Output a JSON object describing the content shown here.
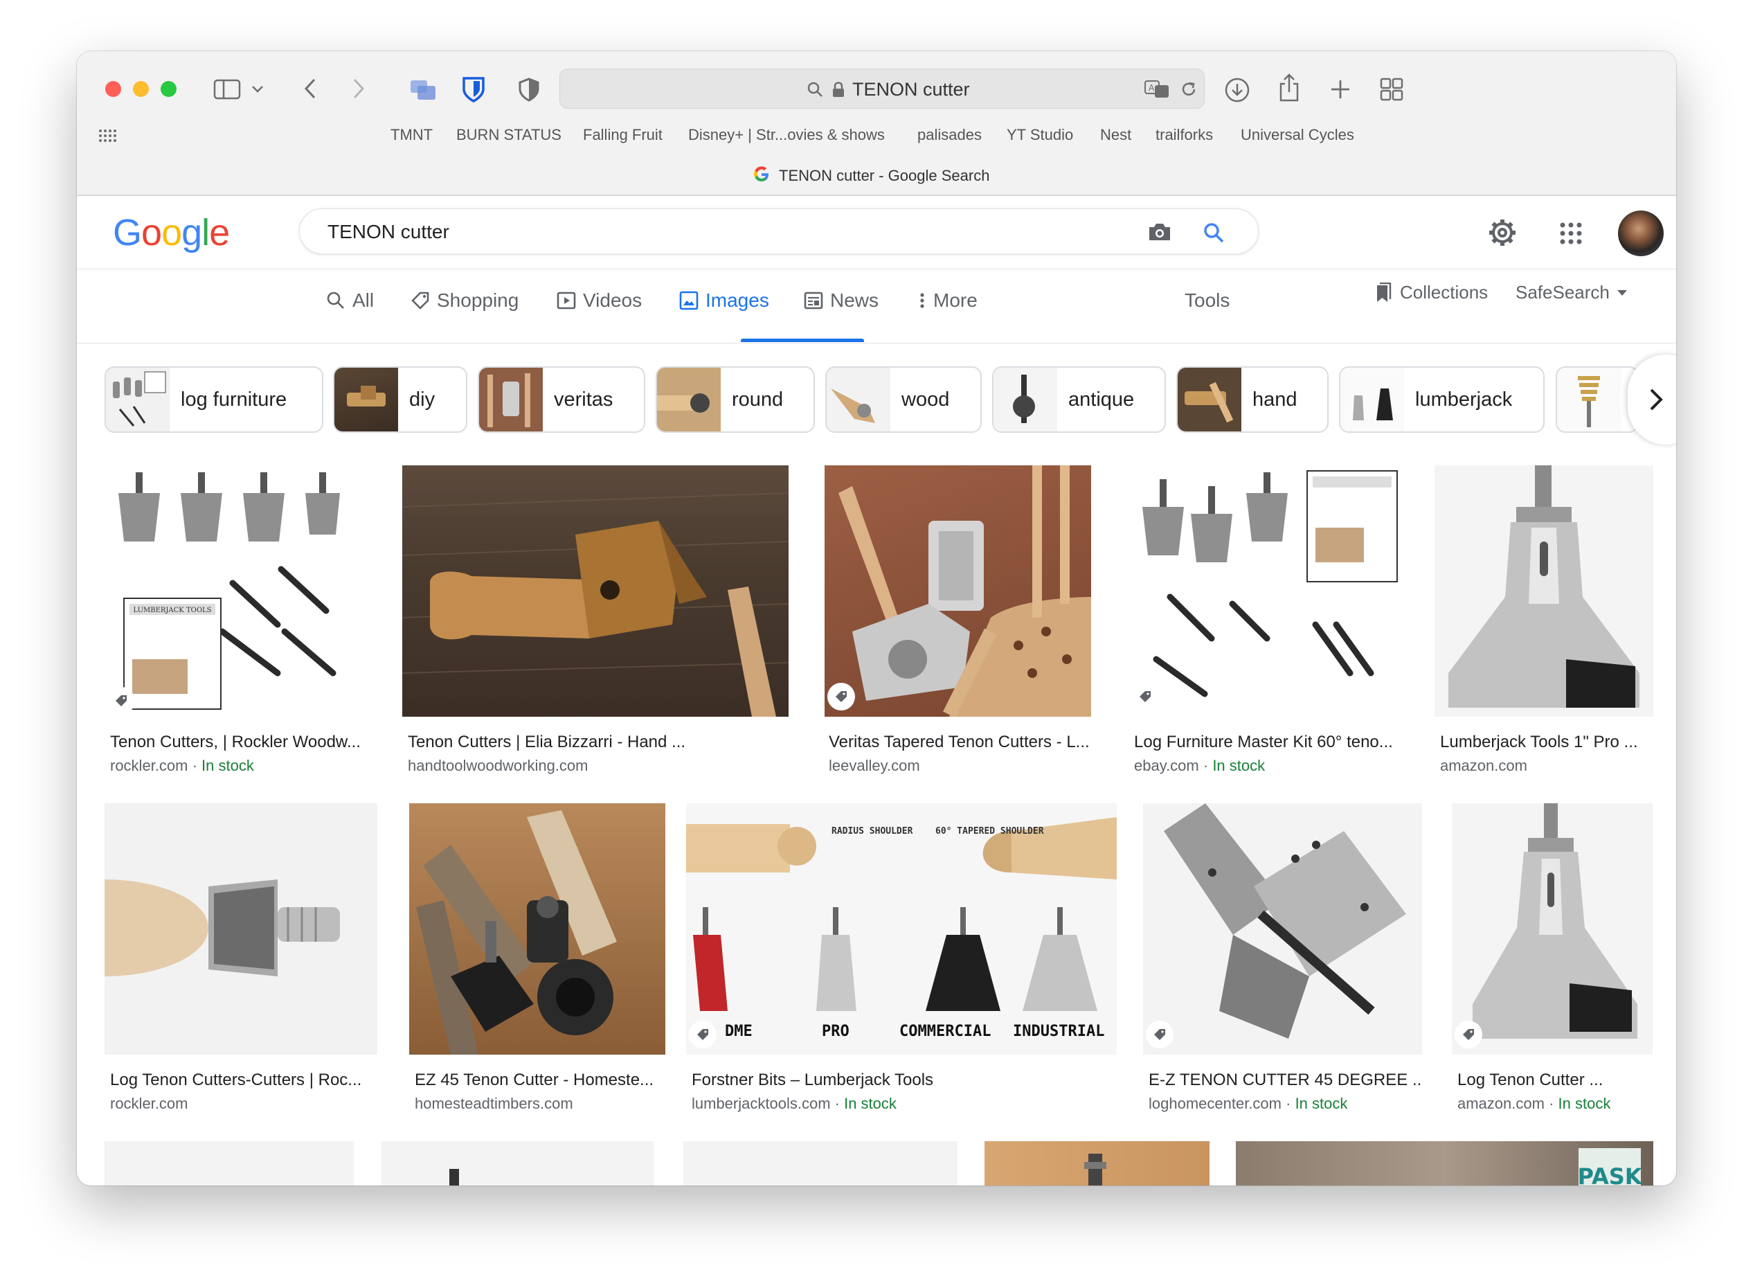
{
  "browser": {
    "url": "TENON cutter",
    "tab_title": "TENON cutter - Google Search",
    "bookmarks": [
      "TMNT",
      "BURN STATUS",
      "Falling Fruit",
      "Disney+ | Str...ovies & shows",
      "palisades",
      "YT Studio",
      "Nest",
      "trailforks",
      "Universal Cycles"
    ]
  },
  "google": {
    "logo": "Google",
    "query": "TENON cutter",
    "tabs": [
      "All",
      "Shopping",
      "Videos",
      "Images",
      "News",
      "More"
    ],
    "tools": "Tools",
    "collections": "Collections",
    "safesearch": "SafeSearch"
  },
  "chips": [
    "log furniture",
    "diy",
    "veritas",
    "round",
    "wood",
    "antique",
    "hand",
    "lumberjack"
  ],
  "results_row1": [
    {
      "title": "Tenon Cutters, | Rockler Woodw...",
      "source": "rockler.com",
      "stock": "In stock"
    },
    {
      "title": "Tenon Cutters | Elia Bizzarri - Hand ...",
      "source": "handtoolwoodworking.com",
      "stock": ""
    },
    {
      "title": "Veritas Tapered Tenon Cutters - L...",
      "source": "leevalley.com",
      "stock": ""
    },
    {
      "title": "Log Furniture Master Kit 60° teno...",
      "source": "ebay.com",
      "stock": "In stock"
    },
    {
      "title": "Lumberjack Tools 1\" Pro ...",
      "source": "amazon.com",
      "stock": ""
    }
  ],
  "results_row2": [
    {
      "title": "Log Tenon Cutters-Cutters | Roc...",
      "source": "rockler.com",
      "stock": ""
    },
    {
      "title": "EZ 45 Tenon Cutter - Homeste...",
      "source": "homesteadtimbers.com",
      "stock": ""
    },
    {
      "title": "Forstner Bits – Lumberjack Tools",
      "source": "lumberjacktools.com",
      "stock": "In stock"
    },
    {
      "title": "E-Z TENON CUTTER 45 DEGREE ...",
      "source": "loghomecenter.com",
      "stock": "In stock"
    },
    {
      "title": "Log Tenon Cutter ...",
      "source": "amazon.com",
      "stock": "In stock"
    }
  ],
  "image_text": {
    "radius_shoulder": "RADIUS SHOULDER",
    "tapered_shoulder": "60° TAPERED SHOULDER",
    "dome": "DME",
    "pro": "PRO",
    "commercial": "COMMERCIAL",
    "industrial": "INDUSTRIAL",
    "lumberjack_tools": "LUMBERJACK TOOLS",
    "pask": "PASK"
  }
}
